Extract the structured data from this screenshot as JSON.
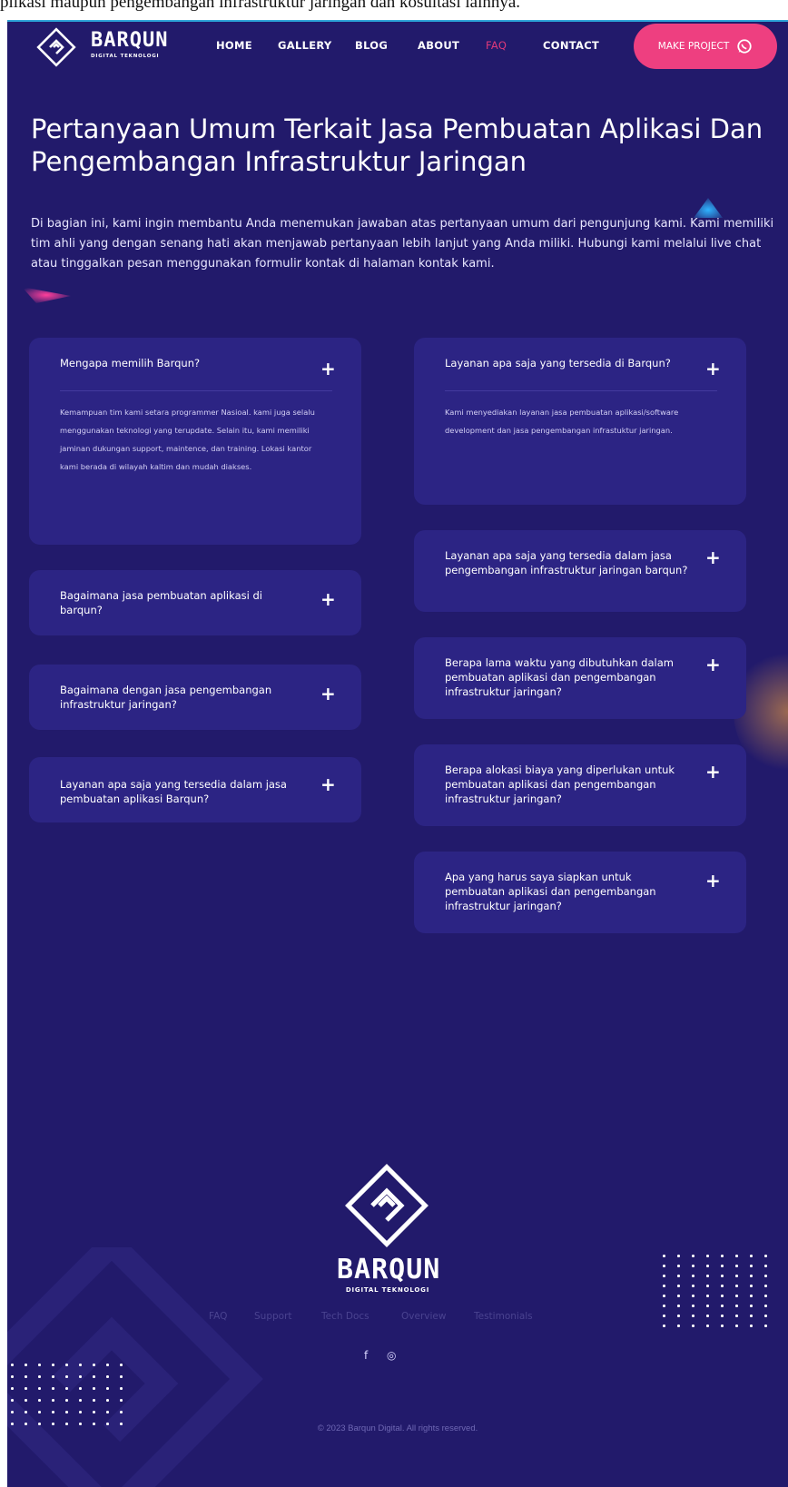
{
  "top_overflow_text": "plikasi maupun pengembangan infrastruktur jaringan dan kosultasi lainnya.",
  "brand": {
    "name": "BARQUN",
    "tagline": "DIGITAL TEKNOLOGI"
  },
  "nav": {
    "items": [
      {
        "label": "HOME"
      },
      {
        "label": "GALLERY"
      },
      {
        "label": "BLOG"
      },
      {
        "label": "ABOUT"
      },
      {
        "label": "FAQ",
        "active": true
      },
      {
        "label": "CONTACT"
      }
    ],
    "cta_label": "MAKE PROJECT",
    "cta_icon": "whatsapp-icon"
  },
  "hero": {
    "title": "Pertanyaan Umum Terkait Jasa Pembuatan Aplikasi Dan Pengembangan Infrastruktur Jaringan",
    "intro": "Di bagian ini, kami ingin membantu Anda menemukan jawaban atas pertanyaan umum dari pengunjung kami. Kami memiliki tim ahli yang dengan senang hati akan menjawab pertanyaan lebih lanjut yang Anda miliki. Hubungi kami melalui live chat atau tinggalkan pesan menggunakan formulir kontak di halaman kontak kami."
  },
  "faq": {
    "left": [
      {
        "question": "Mengapa memilih Barqun?",
        "expanded": true,
        "answer": "Kemampuan tim kami setara programmer Nasioal. kami juga selalu menggunakan teknologi yang terupdate. Selain itu, kami memiliki jaminan dukungan support, maintence, dan training. Lokasi kantor kami berada di wilayah kaltim dan mudah diakses."
      },
      {
        "question": "Bagaimana jasa pembuatan aplikasi di barqun?"
      },
      {
        "question": "Bagaimana dengan jasa pengembangan infrastruktur jaringan?"
      },
      {
        "question": "Layanan apa saja yang tersedia dalam jasa pembuatan aplikasi Barqun?"
      }
    ],
    "right": [
      {
        "question": "Layanan apa saja yang tersedia di Barqun?",
        "expanded": true,
        "answer": "Kami menyediakan layanan jasa pembuatan aplikasi/software development dan jasa pengembangan infrastuktur jaringan."
      },
      {
        "question": "Layanan apa saja yang tersedia dalam jasa pengembangan infrastruktur jaringan barqun?"
      },
      {
        "question": "Berapa lama waktu yang dibutuhkan dalam pembuatan aplikasi dan pengembangan infrastruktur jaringan?"
      },
      {
        "question": "Berapa alokasi biaya yang diperlukan untuk pembuatan aplikasi dan pengembangan infrastruktur jaringan?"
      },
      {
        "question": "Apa yang harus saya siapkan untuk pembuatan aplikasi dan pengembangan infrastruktur jaringan?"
      }
    ],
    "toggle_icon": "plus-icon"
  },
  "footer": {
    "links": [
      "FAQ",
      "Support",
      "Tech Docs",
      "Overview",
      "Testimonials"
    ],
    "social": [
      {
        "icon": "facebook-icon",
        "glyph": "f"
      },
      {
        "icon": "instagram-icon",
        "glyph": "◎"
      }
    ],
    "copyright": "© 2023 Barqun Digital. All rights reserved."
  },
  "colors": {
    "background": "#221a6b",
    "card": "#2c2484",
    "accent_pink": "#ee3f80",
    "active_nav": "#e0397a",
    "footer_link": "#4a4390"
  }
}
